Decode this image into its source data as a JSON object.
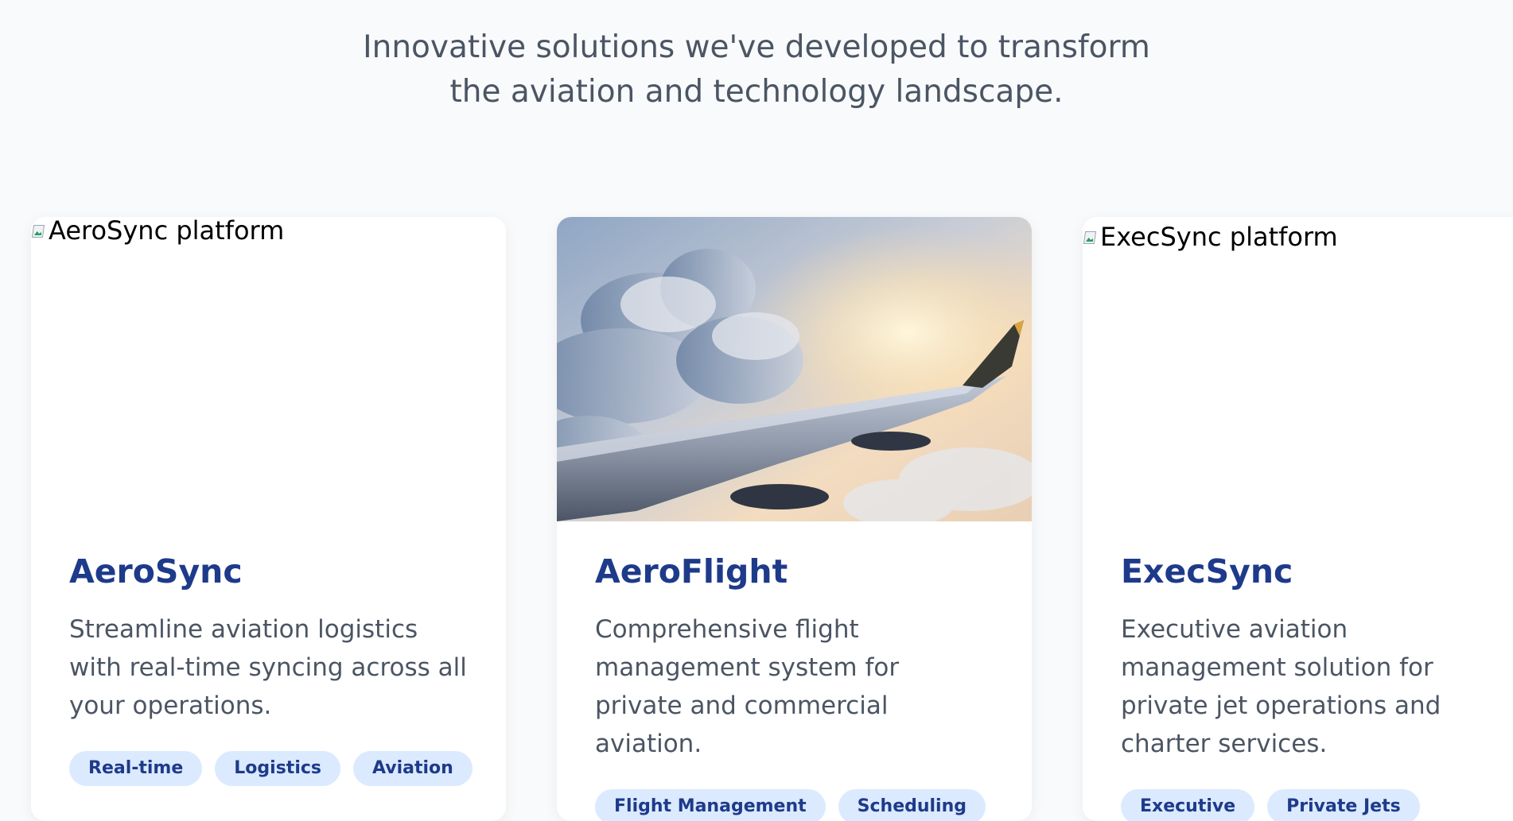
{
  "header": {
    "subtitle": "Innovative solutions we've developed to transform the aviation and technology landscape."
  },
  "cards": [
    {
      "image_alt": "AeroSync platform",
      "image_state": "broken",
      "title": "AeroSync",
      "description": "Streamline aviation logistics with real-time syncing across all your operations.",
      "tags": [
        "Real-time",
        "Logistics",
        "Aviation"
      ]
    },
    {
      "image_alt": "AeroFlight platform",
      "image_state": "photo-airplane-wing-clouds",
      "title": "AeroFlight",
      "description": "Comprehensive flight management system for private and commercial aviation.",
      "tags": [
        "Flight Management",
        "Scheduling"
      ]
    },
    {
      "image_alt": "ExecSync platform",
      "image_state": "broken",
      "title": "ExecSync",
      "description": "Executive aviation management solution for private jet operations and charter services.",
      "tags": [
        "Executive",
        "Private Jets"
      ]
    }
  ],
  "colors": {
    "page_background": "#f8fafc",
    "card_background": "#ffffff",
    "title": "#1e3a8a",
    "body_text": "#4b5563",
    "tag_background": "#dbeafe",
    "tag_text": "#1e3a8a"
  }
}
